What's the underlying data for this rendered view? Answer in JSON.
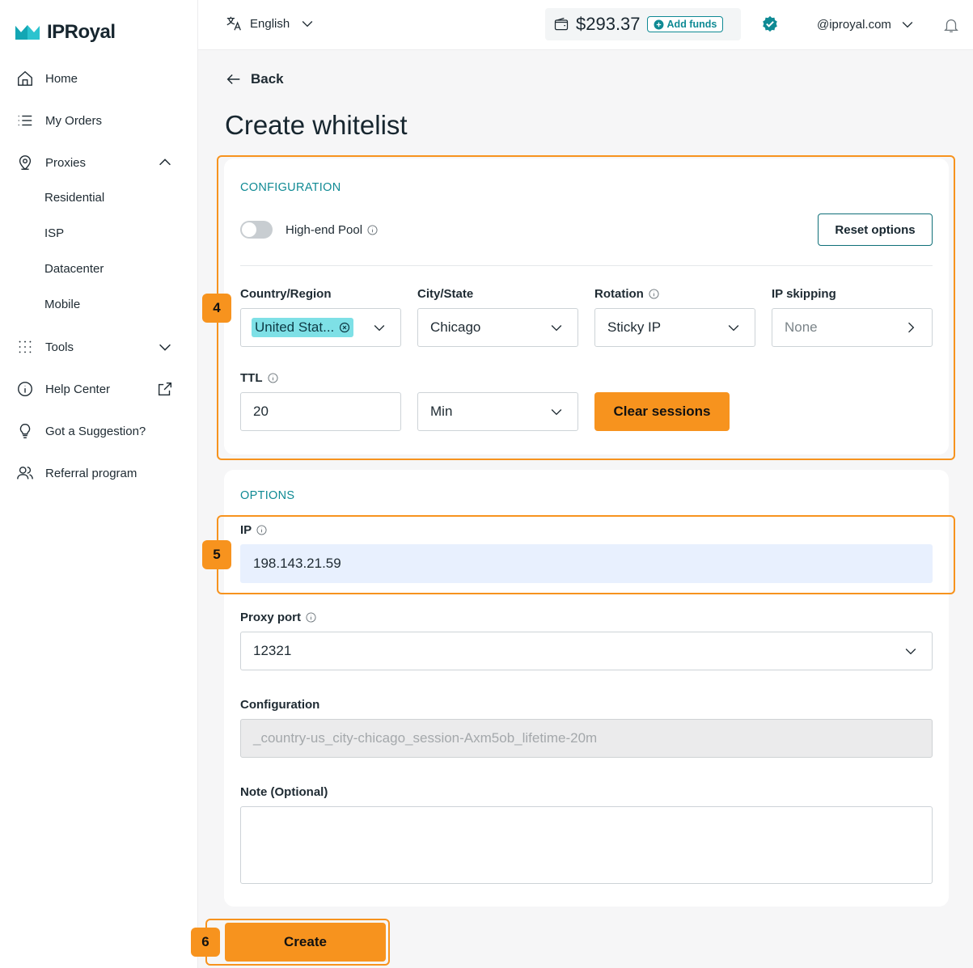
{
  "brand": {
    "name": "IPRoyal",
    "accent": "#0f8a94",
    "highlight": "#f7931e"
  },
  "sidebar": {
    "items": [
      {
        "label": "Home",
        "icon": "home-icon"
      },
      {
        "label": "My Orders",
        "icon": "list-icon"
      },
      {
        "label": "Proxies",
        "icon": "location-pin-icon"
      },
      {
        "label": "Tools",
        "icon": "grid-dots-icon"
      },
      {
        "label": "Help Center",
        "icon": "info-circle-icon"
      },
      {
        "label": "Got a Suggestion?",
        "icon": "lightbulb-icon"
      },
      {
        "label": "Referral program",
        "icon": "users-icon"
      }
    ],
    "proxies_sub": [
      "Residential",
      "ISP",
      "Datacenter",
      "Mobile"
    ]
  },
  "topbar": {
    "language": "English",
    "balance": "$293.37",
    "add_funds": "Add funds",
    "account": "@iproyal.com"
  },
  "page": {
    "back": "Back",
    "title": "Create whitelist"
  },
  "configuration": {
    "section_title": "CONFIGURATION",
    "high_end_pool": "High-end Pool",
    "reset": "Reset options",
    "country_label": "Country/Region",
    "country_value": "United Stat...",
    "city_label": "City/State",
    "city_value": "Chicago",
    "rotation_label": "Rotation",
    "rotation_value": "Sticky IP",
    "ip_skipping_label": "IP skipping",
    "ip_skipping_value": "None",
    "ttl_label": "TTL",
    "ttl_value": "20",
    "ttl_unit": "Min",
    "clear_sessions": "Clear sessions"
  },
  "options": {
    "section_title": "OPTIONS",
    "ip_label": "IP",
    "ip_value": "198.143.21.59",
    "port_label": "Proxy port",
    "port_value": "12321",
    "config_label": "Configuration",
    "config_value": "_country-us_city-chicago_session-Axm5ob_lifetime-20m",
    "note_label": "Note (Optional)"
  },
  "create": "Create",
  "steps": [
    "4",
    "5",
    "6"
  ]
}
